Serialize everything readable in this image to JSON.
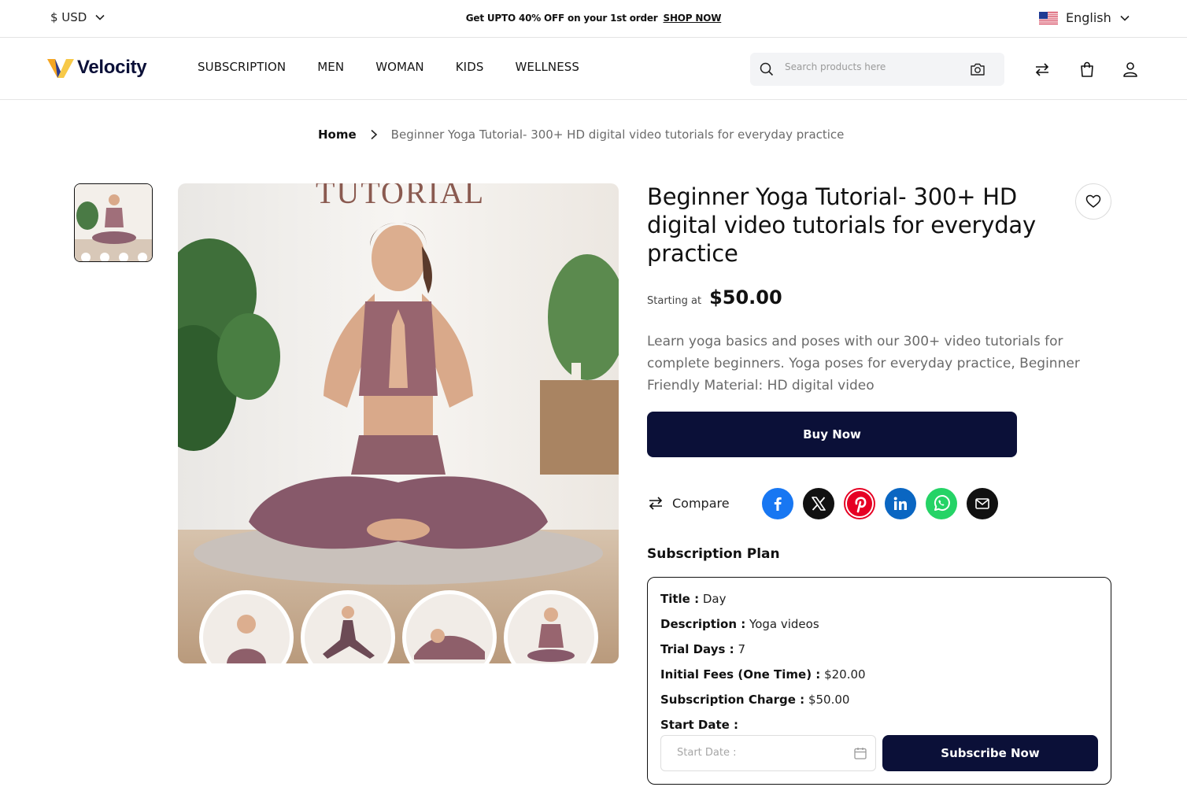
{
  "topbar": {
    "currency": "$ USD",
    "promo_text": "Get UPTO 40% OFF on your 1st order",
    "promo_link": "SHOP NOW",
    "language": "English"
  },
  "header": {
    "brand": "Velocity",
    "nav": [
      "SUBSCRIPTION",
      "MEN",
      "WOMAN",
      "KIDS",
      "WELLNESS"
    ],
    "search_placeholder": "Search products here",
    "icons": [
      "compare-icon",
      "bag-icon",
      "user-icon"
    ]
  },
  "breadcrumb": {
    "home": "Home",
    "current": "Beginner Yoga Tutorial- 300+ HD digital video tutorials for everyday practice"
  },
  "gallery": {
    "overlay_text": "TUTORIAL"
  },
  "product": {
    "title": "Beginner Yoga Tutorial- 300+ HD digital video tutorials for everyday practice",
    "price_label": "Starting at",
    "price": "$50.00",
    "description": "Learn yoga basics and poses with our 300+ video tutorials for complete beginners. Yoga poses for everyday practice, Beginner Friendly Material: HD digital video",
    "buy_label": "Buy Now",
    "compare_label": "Compare",
    "share": [
      {
        "name": "facebook",
        "color": "#1877f2"
      },
      {
        "name": "x",
        "color": "#111111"
      },
      {
        "name": "pinterest",
        "color": "#e60023"
      },
      {
        "name": "linkedin",
        "color": "#0a66c2"
      },
      {
        "name": "whatsapp",
        "color": "#25d366"
      },
      {
        "name": "email",
        "color": "#111111"
      }
    ]
  },
  "plan": {
    "heading": "Subscription Plan",
    "rows": [
      {
        "label": "Title :",
        "value": "Day"
      },
      {
        "label": "Description :",
        "value": "Yoga videos"
      },
      {
        "label": "Trial Days :",
        "value": "7"
      },
      {
        "label": "Initial Fees (One Time) :",
        "value": "$20.00"
      },
      {
        "label": "Subscription Charge :",
        "value": "$50.00"
      },
      {
        "label": "Start Date :",
        "value": ""
      }
    ],
    "date_placeholder": "Start Date :",
    "subscribe_label": "Subscribe Now"
  },
  "colors": {
    "primary": "#0b1038",
    "logo_orange": "#f5a623",
    "logo_yellow": "#f7c948"
  }
}
